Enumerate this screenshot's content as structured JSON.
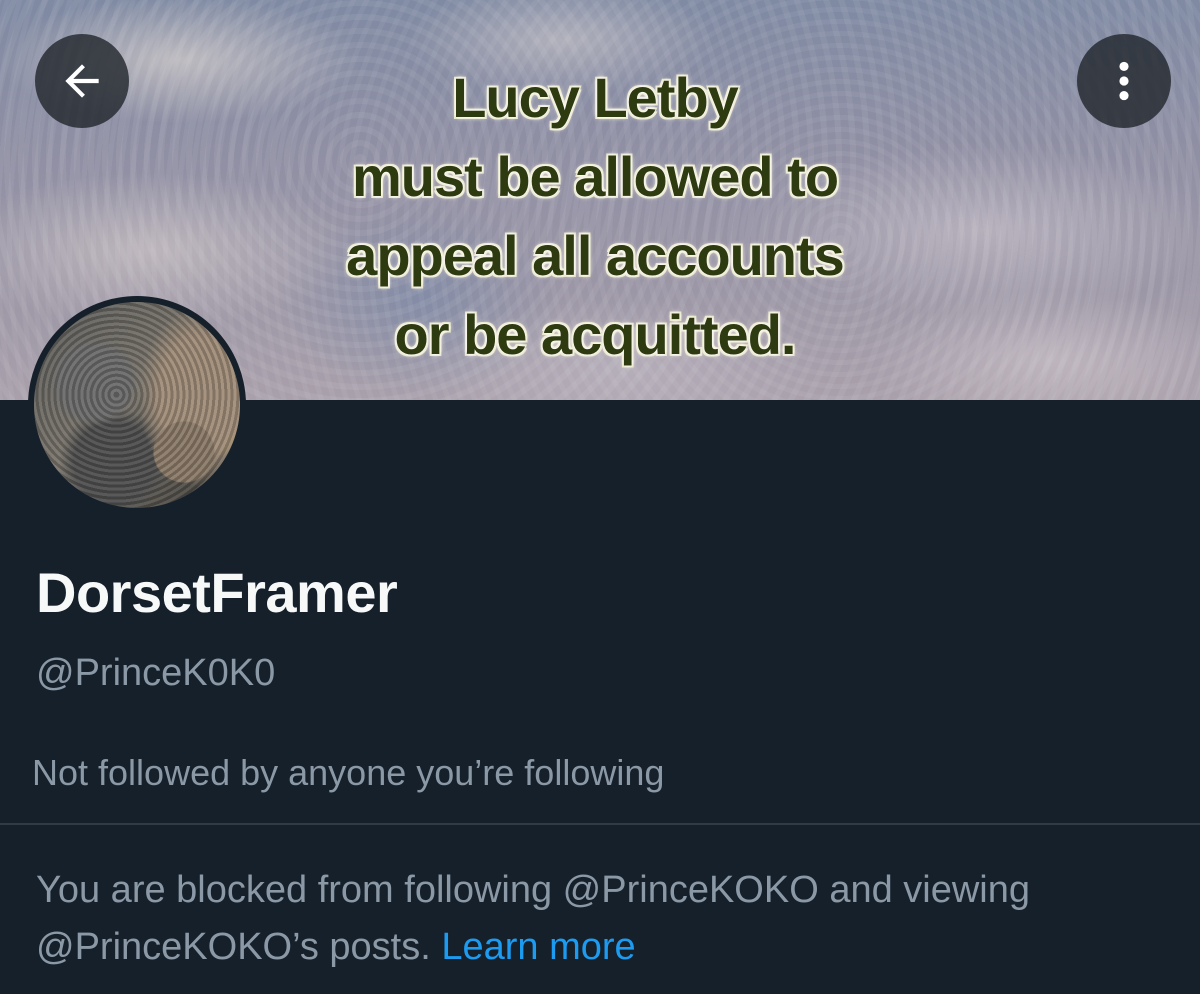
{
  "banner": {
    "lines": [
      "Lucy Letby",
      "must be allowed to",
      "appeal all accounts",
      "or be acquitted."
    ]
  },
  "header": {
    "back_icon": "arrow-left-icon",
    "more_icon": "more-vertical-icon"
  },
  "profile": {
    "display_name": "DorsetFramer",
    "handle": "@PrinceK0K0",
    "followed_by": "Not followed by anyone you’re following"
  },
  "blocked": {
    "message": "You are blocked from following @PrinceKOKO and viewing @PrinceKOKO’s posts.",
    "link_text": "Learn more"
  },
  "colors": {
    "background": "#15202b",
    "text_primary": "#f7f9f9",
    "text_secondary": "#8b98a5",
    "link": "#1d9bf0"
  }
}
